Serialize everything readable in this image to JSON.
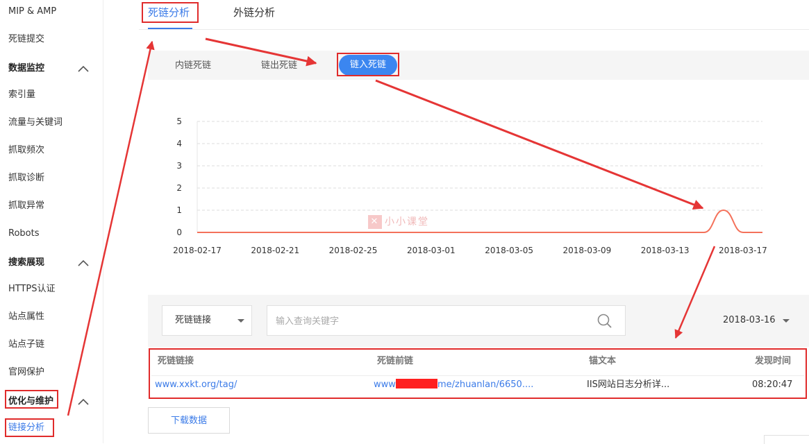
{
  "sidebar": {
    "items": [
      {
        "label": "MIP & AMP",
        "type": "item"
      },
      {
        "label": "死链提交",
        "type": "item"
      },
      {
        "label": "数据监控",
        "type": "section"
      },
      {
        "label": "索引量",
        "type": "item"
      },
      {
        "label": "流量与关键词",
        "type": "item"
      },
      {
        "label": "抓取频次",
        "type": "item"
      },
      {
        "label": "抓取诊断",
        "type": "item"
      },
      {
        "label": "抓取异常",
        "type": "item"
      },
      {
        "label": "Robots",
        "type": "item"
      },
      {
        "label": "搜索展现",
        "type": "section"
      },
      {
        "label": "HTTPS认证",
        "type": "item"
      },
      {
        "label": "站点属性",
        "type": "item"
      },
      {
        "label": "站点子链",
        "type": "item"
      },
      {
        "label": "官网保护",
        "type": "item"
      },
      {
        "label": "优化与维护",
        "type": "section"
      },
      {
        "label": "链接分析",
        "type": "item",
        "active": true
      }
    ]
  },
  "tabs": [
    {
      "label": "死链分析",
      "active": true
    },
    {
      "label": "外链分析",
      "active": false
    }
  ],
  "subtabs": [
    {
      "label": "内链死链",
      "active": false
    },
    {
      "label": "链出死链",
      "active": false
    },
    {
      "label": "链入死链",
      "active": true
    }
  ],
  "watermark": {
    "text": "小小课堂",
    "icon": "x-logo"
  },
  "chart_data": {
    "type": "line",
    "x": [
      "2018-02-17",
      "2018-02-18",
      "2018-02-19",
      "2018-02-20",
      "2018-02-21",
      "2018-02-22",
      "2018-02-23",
      "2018-02-24",
      "2018-02-25",
      "2018-02-26",
      "2018-02-27",
      "2018-02-28",
      "2018-03-01",
      "2018-03-02",
      "2018-03-03",
      "2018-03-04",
      "2018-03-05",
      "2018-03-06",
      "2018-03-07",
      "2018-03-08",
      "2018-03-09",
      "2018-03-10",
      "2018-03-11",
      "2018-03-12",
      "2018-03-13",
      "2018-03-14",
      "2018-03-15",
      "2018-03-16",
      "2018-03-17",
      "2018-03-18"
    ],
    "xticks": [
      "2018-02-17",
      "2018-02-21",
      "2018-02-25",
      "2018-03-01",
      "2018-03-05",
      "2018-03-09",
      "2018-03-13",
      "2018-03-17"
    ],
    "series": [
      {
        "values": [
          0,
          0,
          0,
          0,
          0,
          0,
          0,
          0,
          0,
          0,
          0,
          0,
          0,
          0,
          0,
          0,
          0,
          0,
          0,
          0,
          0,
          0,
          0,
          0,
          0,
          0,
          0,
          1,
          0,
          0
        ],
        "color": "#f4715a"
      }
    ],
    "yticks": [
      0,
      1,
      2,
      3,
      4,
      5
    ],
    "ylim": [
      0,
      5
    ],
    "grid": true,
    "title": "",
    "xlabel": "",
    "ylabel": ""
  },
  "filter": {
    "type_select": "死链链接",
    "search_placeholder": "输入查询关键字",
    "date_select": "2018-03-16"
  },
  "table": {
    "headers": [
      "死链链接",
      "死链前链",
      "锚文本",
      "发现时间"
    ],
    "rows": [
      {
        "dead_link": "www.xxkt.org/tag/",
        "prev_link_prefix": "www",
        "prev_link_suffix": "me/zhuanlan/6650....",
        "anchor": "IIS网站日志分析详...",
        "time": "08:20:47"
      }
    ]
  },
  "download_label": "下载数据",
  "colors": {
    "accent": "#3b7be8",
    "annotation": "#e02b2b",
    "line": "#f4715a"
  }
}
